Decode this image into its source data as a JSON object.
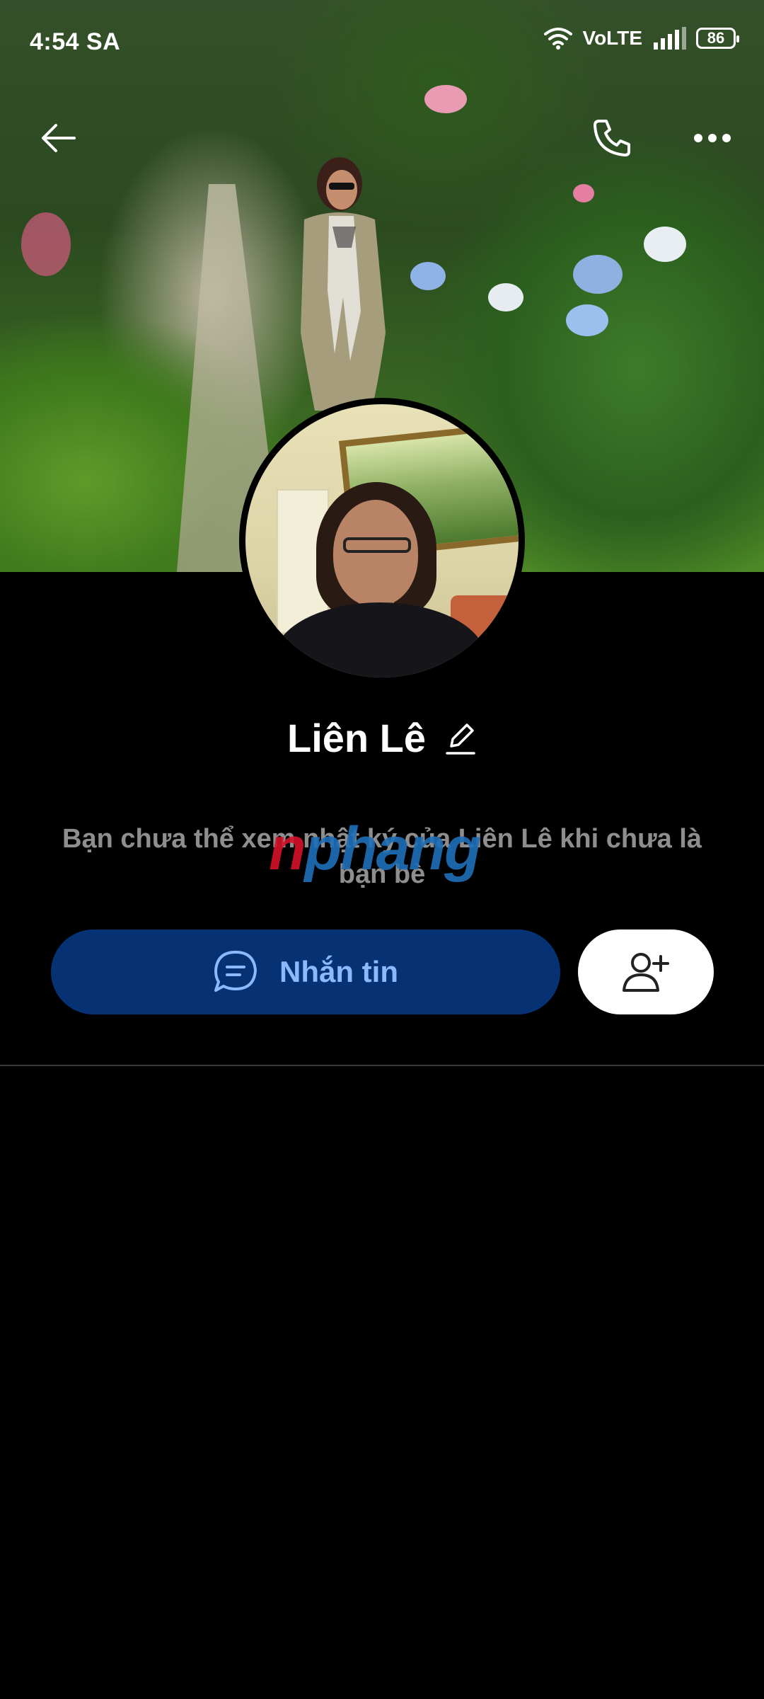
{
  "status_bar": {
    "time": "4:54 SA",
    "network": "VoLTE",
    "battery": "86"
  },
  "icons": {
    "back": "arrow-left-icon",
    "call": "phone-icon",
    "more": "more-horizontal-icon",
    "edit": "pencil-icon",
    "message": "chat-bubble-icon",
    "add_friend": "user-plus-icon"
  },
  "profile": {
    "name": "Liên Lê",
    "privacy_notice": "Bạn chưa thể xem nhật ký của Liên Lê khi chưa là bạn bè"
  },
  "watermark": {
    "part1": "n",
    "part2": "phang"
  },
  "actions": {
    "message_label": "Nhắn tin"
  },
  "colors": {
    "message_button": "#063172",
    "message_text": "#8ab9ff",
    "add_friend_button": "#ffffff",
    "background": "#000000",
    "notice_text": "#8e8e8e"
  }
}
